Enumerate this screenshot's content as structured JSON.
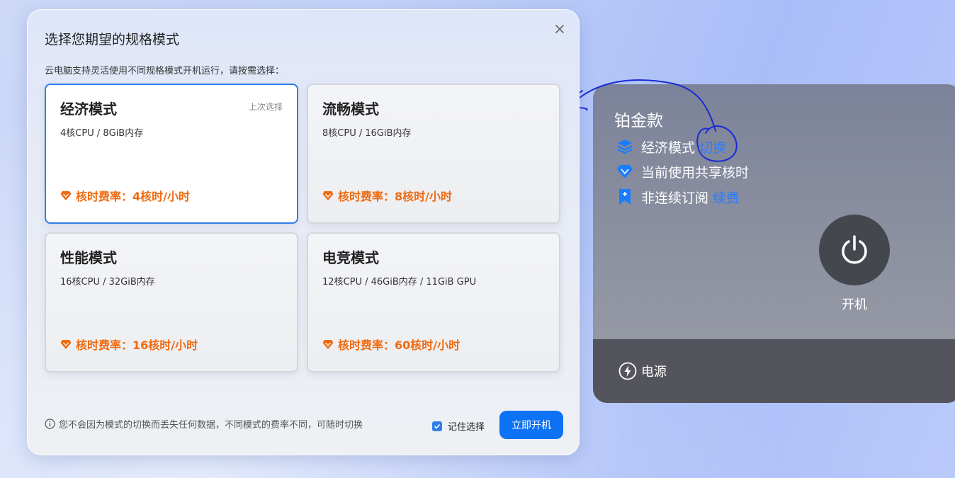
{
  "dialog": {
    "title": "选择您期望的规格模式",
    "subtitle": "云电脑支持灵活使用不同规格模式开机运行，请按需选择：",
    "cards": [
      {
        "title": "经济模式",
        "spec": "4核CPU / 8GiB内存",
        "tag": "上次选择",
        "rate": "核时费率：4核时/小时",
        "selected": true
      },
      {
        "title": "流畅模式",
        "spec": "8核CPU / 16GiB内存",
        "rate": "核时费率：8核时/小时",
        "selected": false
      },
      {
        "title": "性能模式",
        "spec": "16核CPU / 32GiB内存",
        "rate": "核时费率：16核时/小时",
        "selected": false
      },
      {
        "title": "电竞模式",
        "spec": "12核CPU / 46GiB内存 / 11GiB GPU",
        "rate": "核时费率：60核时/小时",
        "selected": false
      }
    ],
    "note": "您不会因为模式的切换而丢失任何数据，不同模式的费率不同，可随时切换",
    "remember_label": "记住选择",
    "remember_checked": true,
    "start_label": "立即开机"
  },
  "panel": {
    "title": "铂金款",
    "mode_label": "经济模式",
    "switch_link": "切换",
    "core_label": "当前使用共享核时",
    "sub_label": "非连续订阅",
    "renew_link": "续费",
    "power_label": "开机",
    "footer_label": "电源"
  },
  "colors": {
    "accent": "#0e72f5",
    "rate": "#f06a0f",
    "link": "#2b7cff",
    "panel_footer": "#54555c"
  }
}
